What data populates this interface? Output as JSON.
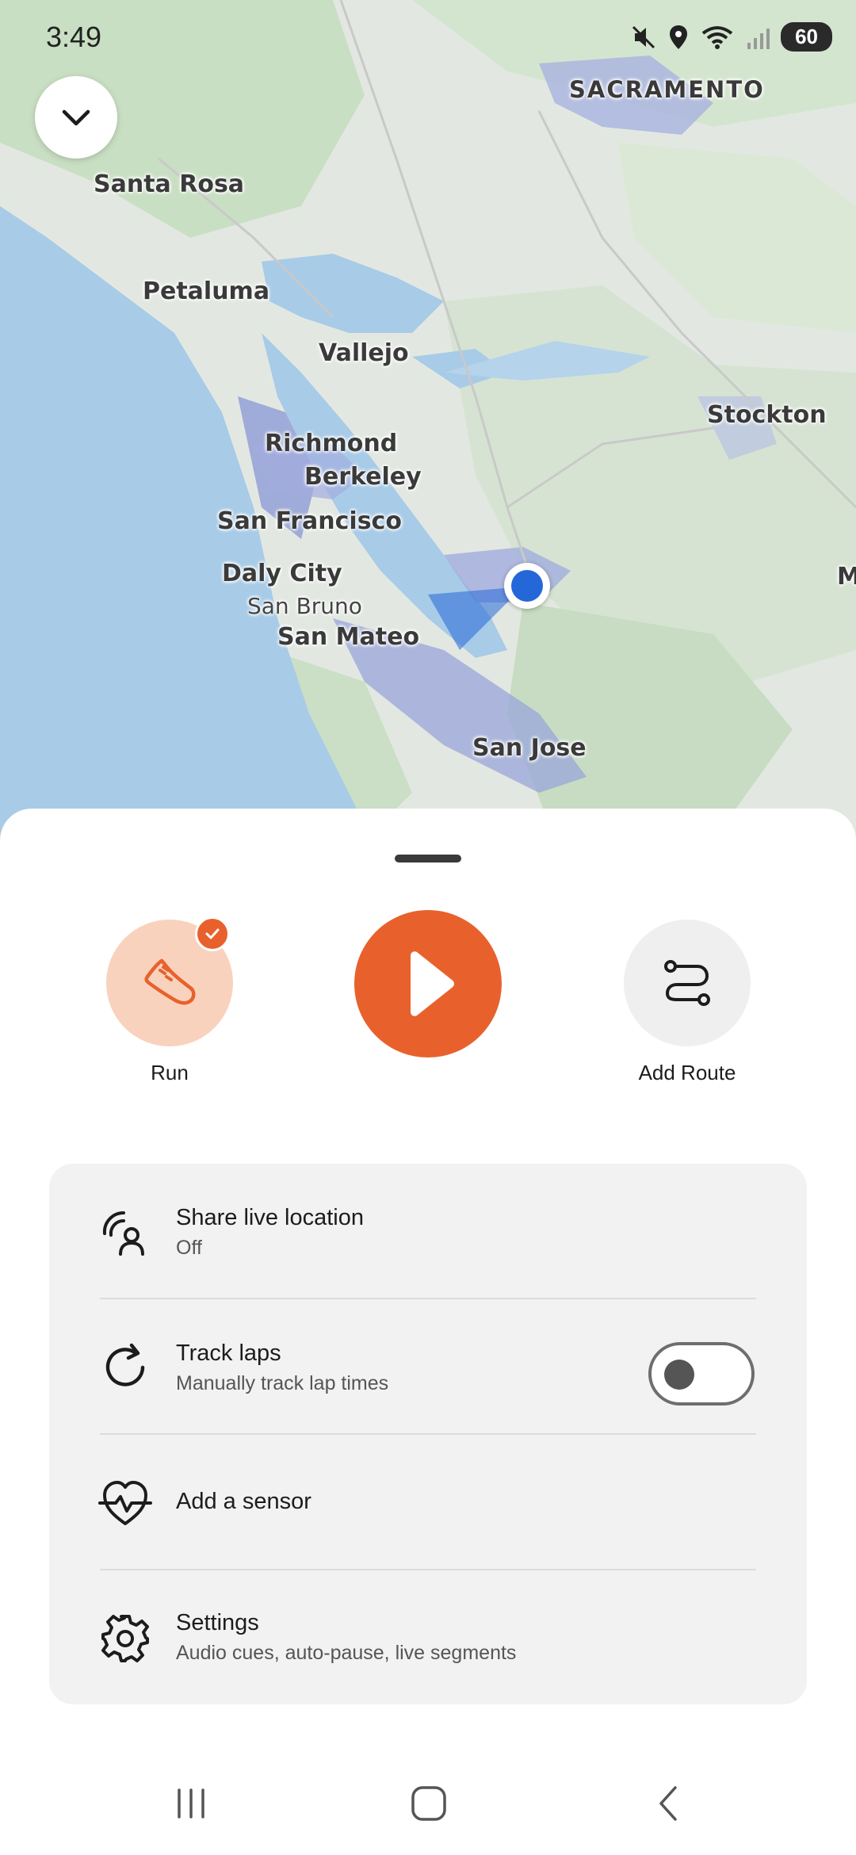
{
  "status_bar": {
    "time": "3:49",
    "battery": "60"
  },
  "map": {
    "labels": {
      "sacramento": "SACRAMENTO",
      "santa_rosa": "Santa Rosa",
      "petaluma": "Petaluma",
      "vallejo": "Vallejo",
      "stockton": "Stockton",
      "richmond": "Richmond",
      "berkeley": "Berkeley",
      "san_francisco": "San Francisco",
      "daly_city": "Daly City",
      "san_bruno": "San Bruno",
      "san_mateo": "San Mateo",
      "san_jose": "San Jose",
      "edge_m": "M"
    },
    "collapse_icon": "chevron-down-icon"
  },
  "activity": {
    "sport_label": "Run",
    "sport_icon": "running-shoe-icon",
    "selected_icon": "checkmark-icon",
    "start_icon": "play-icon",
    "route_label": "Add Route",
    "route_icon": "route-icon"
  },
  "options": [
    {
      "title": "Share live location",
      "subtitle": "Off",
      "icon": "live-location-icon"
    },
    {
      "title": "Track laps",
      "subtitle": "Manually track lap times",
      "icon": "refresh-icon",
      "toggle_on": false
    },
    {
      "title": "Add a sensor",
      "subtitle": "",
      "icon": "heart-rate-icon"
    },
    {
      "title": "Settings",
      "subtitle": "Audio cues, auto-pause, live segments",
      "icon": "gear-icon"
    }
  ],
  "colors": {
    "accent": "#e8612c",
    "accent_light": "#f9d2bd",
    "location_blue": "#2467d9"
  }
}
